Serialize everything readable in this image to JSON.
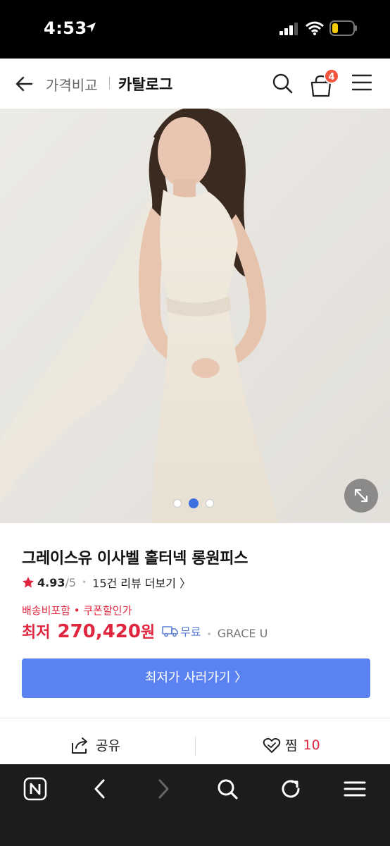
{
  "status_bar": {
    "time": "4:53"
  },
  "header": {
    "breadcrumb": "가격비교",
    "title": "카탈로그",
    "cart_count": "4"
  },
  "gallery": {
    "slide_count": 3,
    "active_slide": 2
  },
  "product": {
    "name": "그레이스유 이사벨 홀터넥 롱원피스",
    "rating": "4.93",
    "rating_max": "/5",
    "review_link": "15건 리뷰 더보기 〉",
    "benefits": "배송비포함 • 쿠폰할인가",
    "price_label": "최저",
    "price": "270,420",
    "price_unit": "원",
    "shipping": "무료",
    "seller": "GRACE U",
    "buy_button": "최저가 사러가기 〉"
  },
  "actions": {
    "share": "공유",
    "wish": "찜",
    "wish_count": "10"
  },
  "colors": {
    "accent_blue": "#5a82f0",
    "price_red": "#e0263f",
    "badge_red": "#f2543d"
  },
  "browser_bar": {
    "icons": [
      "naver-home-icon",
      "back-arrow-icon",
      "forward-arrow-icon",
      "search-icon",
      "reload-icon",
      "menu-icon"
    ]
  }
}
